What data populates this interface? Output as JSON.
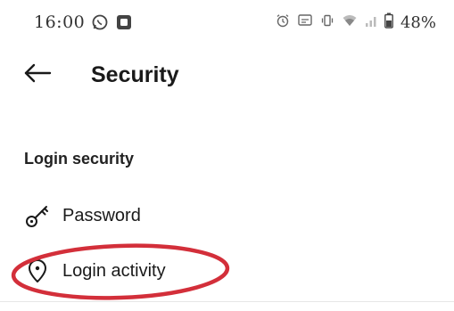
{
  "status_bar": {
    "time": "16:00",
    "left_icons": [
      "whatsapp-icon",
      "square-app-icon"
    ],
    "right_icons": [
      "alarm-icon",
      "cast-icon",
      "vibrate-icon",
      "wifi-icon",
      "signal-icon",
      "battery-icon"
    ],
    "battery_percent": "48%"
  },
  "app_bar": {
    "back_icon": "arrow-left-icon",
    "title": "Security"
  },
  "section": {
    "title": "Login security",
    "items": [
      {
        "label": "Password",
        "icon": "key-icon"
      },
      {
        "label": "Login activity",
        "icon": "location-pin-icon"
      }
    ]
  },
  "annotation": {
    "color": "#d32f3a",
    "target": "Login activity"
  }
}
